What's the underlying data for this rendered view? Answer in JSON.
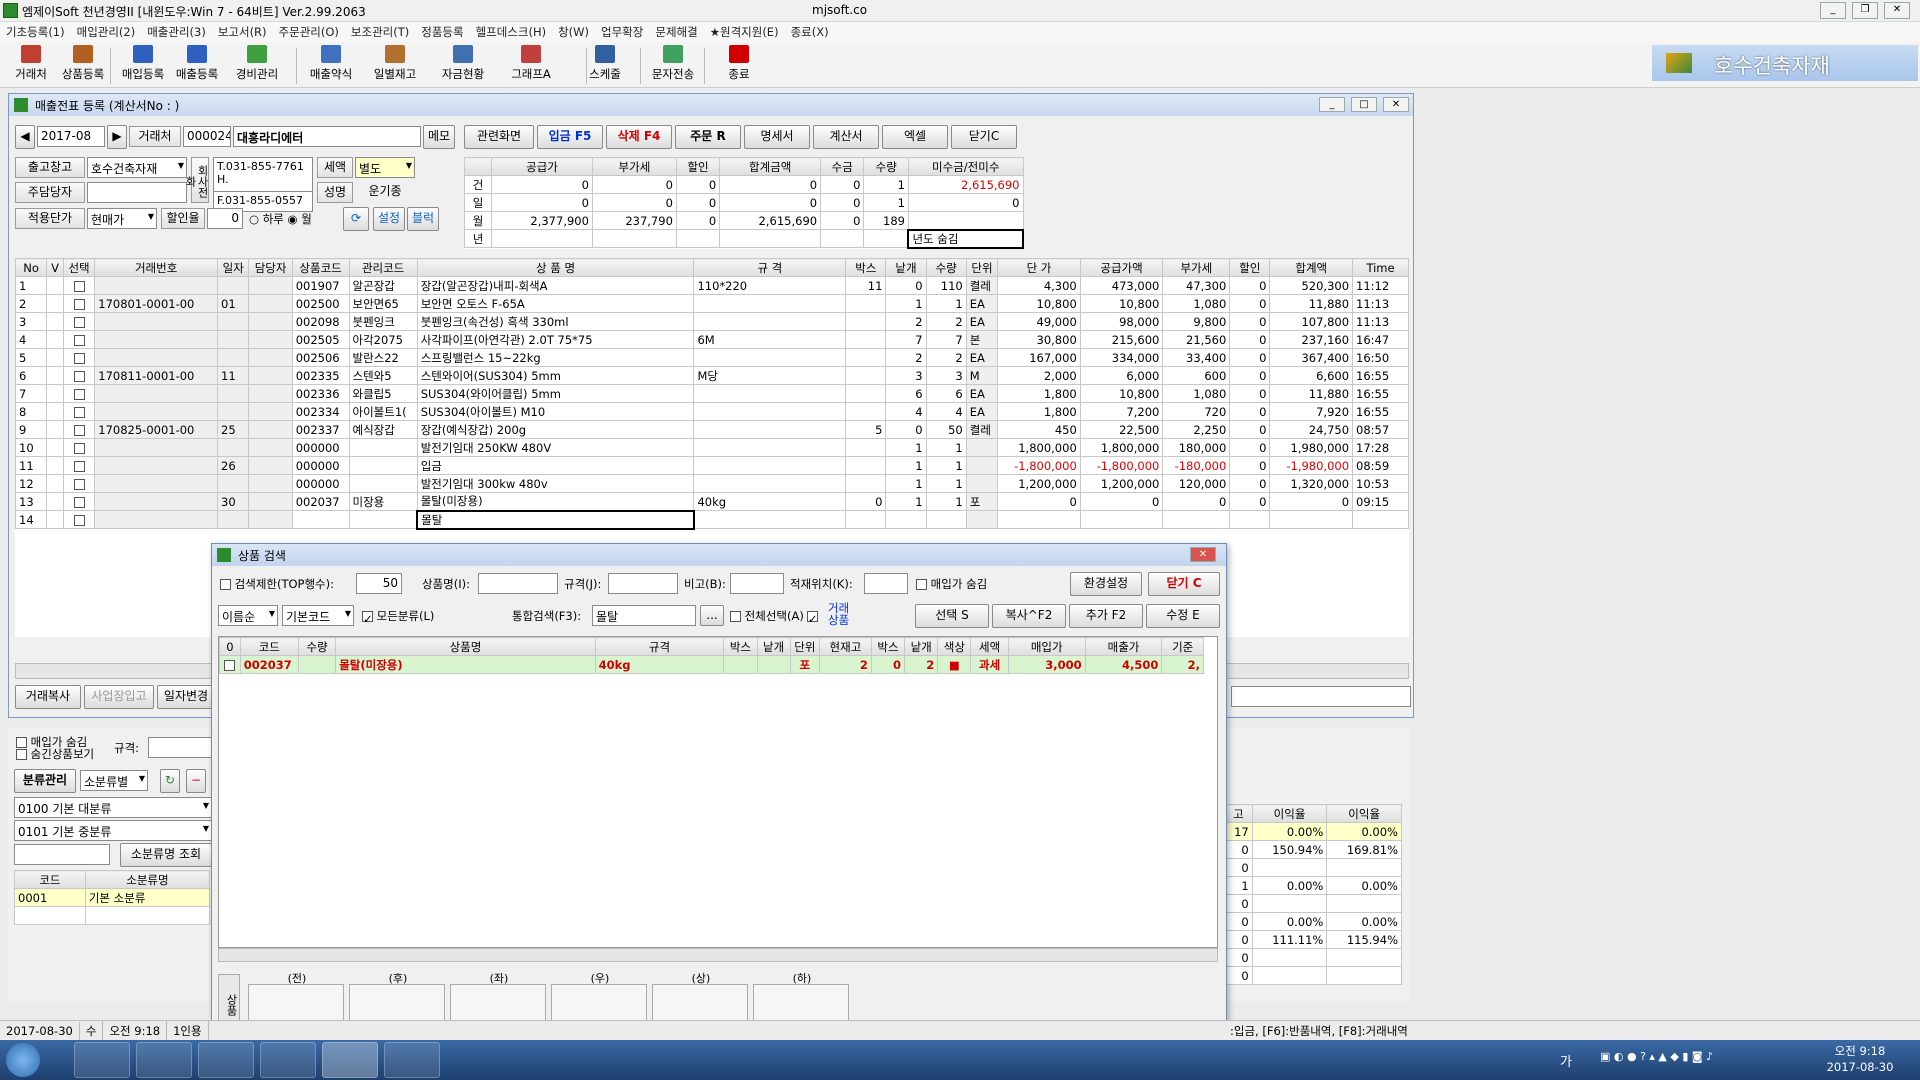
{
  "window": {
    "title": "엠제이Soft 천년경영II [내윈도우:Win 7 - 64비트] Ver.2.99.2063",
    "url": "mjsoft.co"
  },
  "menu": [
    "기초등록(1)",
    "매입관리(2)",
    "매출관리(3)",
    "보고서(R)",
    "주문관리(O)",
    "보조관리(T)",
    "정품등록",
    "헬프데스크(H)",
    "창(W)",
    "업무확장",
    "문제해결",
    "★원격지원(E)",
    "종료(X)"
  ],
  "toolbar": [
    "거래처",
    "상품등록",
    "매입등록",
    "매출등록",
    "경비관리",
    "매출약식",
    "일별재고",
    "자금현황",
    "그래프A",
    "스케줄",
    "문자전송",
    "종료"
  ],
  "logo": {
    "text": "호수건축자재"
  },
  "child": {
    "title": "매출전표 등록 (계산서No : )",
    "date": "2017-08",
    "customer_label": "거래처",
    "customer_code": "000024",
    "customer_name": "대흥라디에터",
    "memo": "메모",
    "buttons": {
      "related": "관련화면",
      "receipt": "입금 F5",
      "delete": "삭제 F4",
      "order": "주문 R",
      "statement": "명세서",
      "invoice": "계산서",
      "excel": "엑셀",
      "close": "닫기C"
    },
    "warehouse_label": "출고창고",
    "warehouse": "호수건축자재",
    "manager_label": "주담당자",
    "phone_side": "회사전화",
    "tel": "T.031-855-7761",
    "hp": "H.",
    "fax": "F.031-855-0557",
    "tax_label": "세액",
    "tax_value": "별도",
    "name_label": "성명",
    "transport_label": "운기종",
    "price_label": "적용단가",
    "price_value": "현매가",
    "discount_label": "할인율",
    "discount_value": "0",
    "radio_day": "하루",
    "radio_month": "월",
    "settings": "설정",
    "block": "블럭",
    "summary": {
      "headers": [
        "",
        "공급가",
        "부가세",
        "할인",
        "합계금액",
        "수금",
        "수량",
        "미수금/전미수"
      ],
      "rows": [
        [
          "건",
          "0",
          "0",
          "0",
          "0",
          "0",
          "1",
          "2,615,690"
        ],
        [
          "일",
          "0",
          "0",
          "0",
          "0",
          "0",
          "1",
          "0"
        ],
        [
          "월",
          "2,377,900",
          "237,790",
          "0",
          "2,615,690",
          "0",
          "189",
          ""
        ],
        [
          "년",
          "",
          "",
          "",
          "",
          "",
          "",
          "년도 숨김"
        ]
      ]
    },
    "grid_headers": [
      "No",
      "V",
      "선택",
      "거래번호",
      "일자",
      "담당자",
      "상품코드",
      "관리코드",
      "상 품 명",
      "규 격",
      "박스",
      "낱개",
      "수량",
      "단위",
      "단 가",
      "공급가액",
      "부가세",
      "할인",
      "합계액",
      "Time"
    ],
    "rows": [
      [
        "1",
        "",
        "",
        "",
        "",
        "",
        "001907",
        "알곤장갑",
        "장갑(알곤장갑)내피-회색A",
        "110*220",
        "11",
        "0",
        "110",
        "켤레",
        "4,300",
        "473,000",
        "47,300",
        "0",
        "520,300",
        "11:12"
      ],
      [
        "2",
        "",
        "",
        "170801-0001-00",
        "01",
        "",
        "002500",
        "보안면65",
        "보안면 오토스 F-65A",
        "",
        "",
        "1",
        "1",
        "EA",
        "10,800",
        "10,800",
        "1,080",
        "0",
        "11,880",
        "11:13"
      ],
      [
        "3",
        "",
        "",
        "",
        "",
        "",
        "002098",
        "붓펜잉크",
        "붓펜잉크(속건성) 흑색 330ml",
        "",
        "",
        "2",
        "2",
        "EA",
        "49,000",
        "98,000",
        "9,800",
        "0",
        "107,800",
        "11:13"
      ],
      [
        "4",
        "",
        "",
        "",
        "",
        "",
        "002505",
        "아각2075",
        "사각파이프(아연각관) 2.0T 75*75",
        "6M",
        "",
        "7",
        "7",
        "본",
        "30,800",
        "215,600",
        "21,560",
        "0",
        "237,160",
        "16:47"
      ],
      [
        "5",
        "",
        "",
        "",
        "",
        "",
        "002506",
        "발란스22",
        "스프링밸런스 15~22kg",
        "",
        "",
        "2",
        "2",
        "EA",
        "167,000",
        "334,000",
        "33,400",
        "0",
        "367,400",
        "16:50"
      ],
      [
        "6",
        "",
        "",
        "170811-0001-00",
        "11",
        "",
        "002335",
        "스텐와5",
        "스텐와이어(SUS304) 5mm",
        "M당",
        "",
        "3",
        "3",
        "M",
        "2,000",
        "6,000",
        "600",
        "0",
        "6,600",
        "16:55"
      ],
      [
        "7",
        "",
        "",
        "",
        "",
        "",
        "002336",
        "와클립5",
        "SUS304(와이어클립) 5mm",
        "",
        "",
        "6",
        "6",
        "EA",
        "1,800",
        "10,800",
        "1,080",
        "0",
        "11,880",
        "16:55"
      ],
      [
        "8",
        "",
        "",
        "",
        "",
        "",
        "002334",
        "아이볼트1(",
        "SUS304(아이볼트) M10",
        "",
        "",
        "4",
        "4",
        "EA",
        "1,800",
        "7,200",
        "720",
        "0",
        "7,920",
        "16:55"
      ],
      [
        "9",
        "",
        "",
        "170825-0001-00",
        "25",
        "",
        "002337",
        "예식장갑",
        "장갑(예식장갑) 200g",
        "",
        "5",
        "0",
        "50",
        "켤레",
        "450",
        "22,500",
        "2,250",
        "0",
        "24,750",
        "08:57"
      ],
      [
        "10",
        "",
        "",
        "",
        "",
        "",
        "000000",
        "",
        "발전기임대 250KW 480V",
        "",
        "",
        "1",
        "1",
        "",
        "1,800,000",
        "1,800,000",
        "180,000",
        "0",
        "1,980,000",
        "17:28"
      ],
      [
        "11",
        "",
        "",
        "",
        "26",
        "",
        "000000",
        "",
        "입금",
        "",
        "",
        "1",
        "1",
        "",
        "-1,800,000",
        "-1,800,000",
        "-180,000",
        "0",
        "-1,980,000",
        "08:59"
      ],
      [
        "12",
        "",
        "",
        "",
        "",
        "",
        "000000",
        "",
        "발전기임대 300kw 480v",
        "",
        "",
        "1",
        "1",
        "",
        "1,200,000",
        "1,200,000",
        "120,000",
        "0",
        "1,320,000",
        "10:53"
      ],
      [
        "13",
        "",
        "",
        "",
        "30",
        "",
        "002037",
        "미장용",
        "몰탈(미장용)",
        "40kg",
        "0",
        "1",
        "1",
        "포",
        "0",
        "0",
        "0",
        "0",
        "0",
        "09:15"
      ],
      [
        "14",
        "",
        "",
        "",
        "",
        "",
        "",
        "",
        "몰탈",
        "",
        "",
        "",
        "",
        "",
        "",
        "",
        "",
        "",
        "",
        ""
      ]
    ],
    "bottom_buttons": [
      "거래복사",
      "사업장입고",
      "일자변경"
    ]
  },
  "left_panel": {
    "hide_purchase": "매입가 숨김",
    "hide_stop": "숨긴상품보기",
    "spec_label": "규격:",
    "class_mgmt": "분류관리",
    "class_select": "소분류별",
    "large": "0100 기본 대분류",
    "mid": "0101 기본 중분류",
    "lookup": "소분류명 조회",
    "headers": [
      "코드",
      "소분류명"
    ],
    "rows": [
      [
        "0001",
        "기본 소분류"
      ]
    ]
  },
  "right_panel": {
    "headers": [
      "고",
      "이익율",
      "이익율"
    ],
    "rows": [
      [
        "17",
        "0.00%",
        "0.00%"
      ],
      [
        "0",
        "150.94%",
        "169.81%"
      ],
      [
        "0",
        "",
        ""
      ],
      [
        "1",
        "0.00%",
        "0.00%"
      ],
      [
        "0",
        "",
        ""
      ],
      [
        "0",
        "0.00%",
        "0.00%"
      ],
      [
        "0",
        "111.11%",
        "115.94%"
      ],
      [
        "0",
        "",
        ""
      ],
      [
        "0",
        "",
        ""
      ]
    ]
  },
  "dialog": {
    "title": "상품 검색",
    "limit_label": "검색제한(TOP행수):",
    "limit_value": "50",
    "name_label": "상품명(I):",
    "spec_label": "규격(J):",
    "note_label": "비고(B):",
    "loc_label": "적재위치(K):",
    "hide_purchase": "매입가 숨김",
    "env": "환경설정",
    "close": "닫기 C",
    "sort": "이름순",
    "code_sort": "기본코드",
    "all_class": "모든분류(L)",
    "unified_label": "통합검색(F3):",
    "unified_value": "몰탈",
    "select_all": "전체선택(A)",
    "trade_goods": "거래상품",
    "select": "선택 S",
    "copy": "복사^F2",
    "add": "추가 F2",
    "edit": "수정 E",
    "headers": [
      "0",
      "코드",
      "수량",
      "상품명",
      "규격",
      "박스",
      "낱개",
      "단위",
      "현재고",
      "박스",
      "낱개",
      "색상",
      "세액",
      "매입가",
      "매출가",
      "기준"
    ],
    "rows": [
      [
        "",
        "002037",
        "",
        "몰탈(미장용)",
        "40kg",
        "",
        "",
        "포",
        "2",
        "0",
        "2",
        "■",
        "과세",
        "3,000",
        "4,500",
        "2,"
      ]
    ],
    "nav": [
      "(전)",
      "(후)",
      "(좌)",
      "(우)",
      "(상)",
      "(하)"
    ],
    "side_label": "상품"
  },
  "statusbar": {
    "date": "2017-08-30",
    "day": "수",
    "time": "오전 9:18",
    "users": "1인용",
    "hint": ":입금, [F6]:반품내역, [F8]:거래내역"
  },
  "tray": {
    "time": "오전 9:18",
    "date": "2017-08-30",
    "ime": "가"
  }
}
